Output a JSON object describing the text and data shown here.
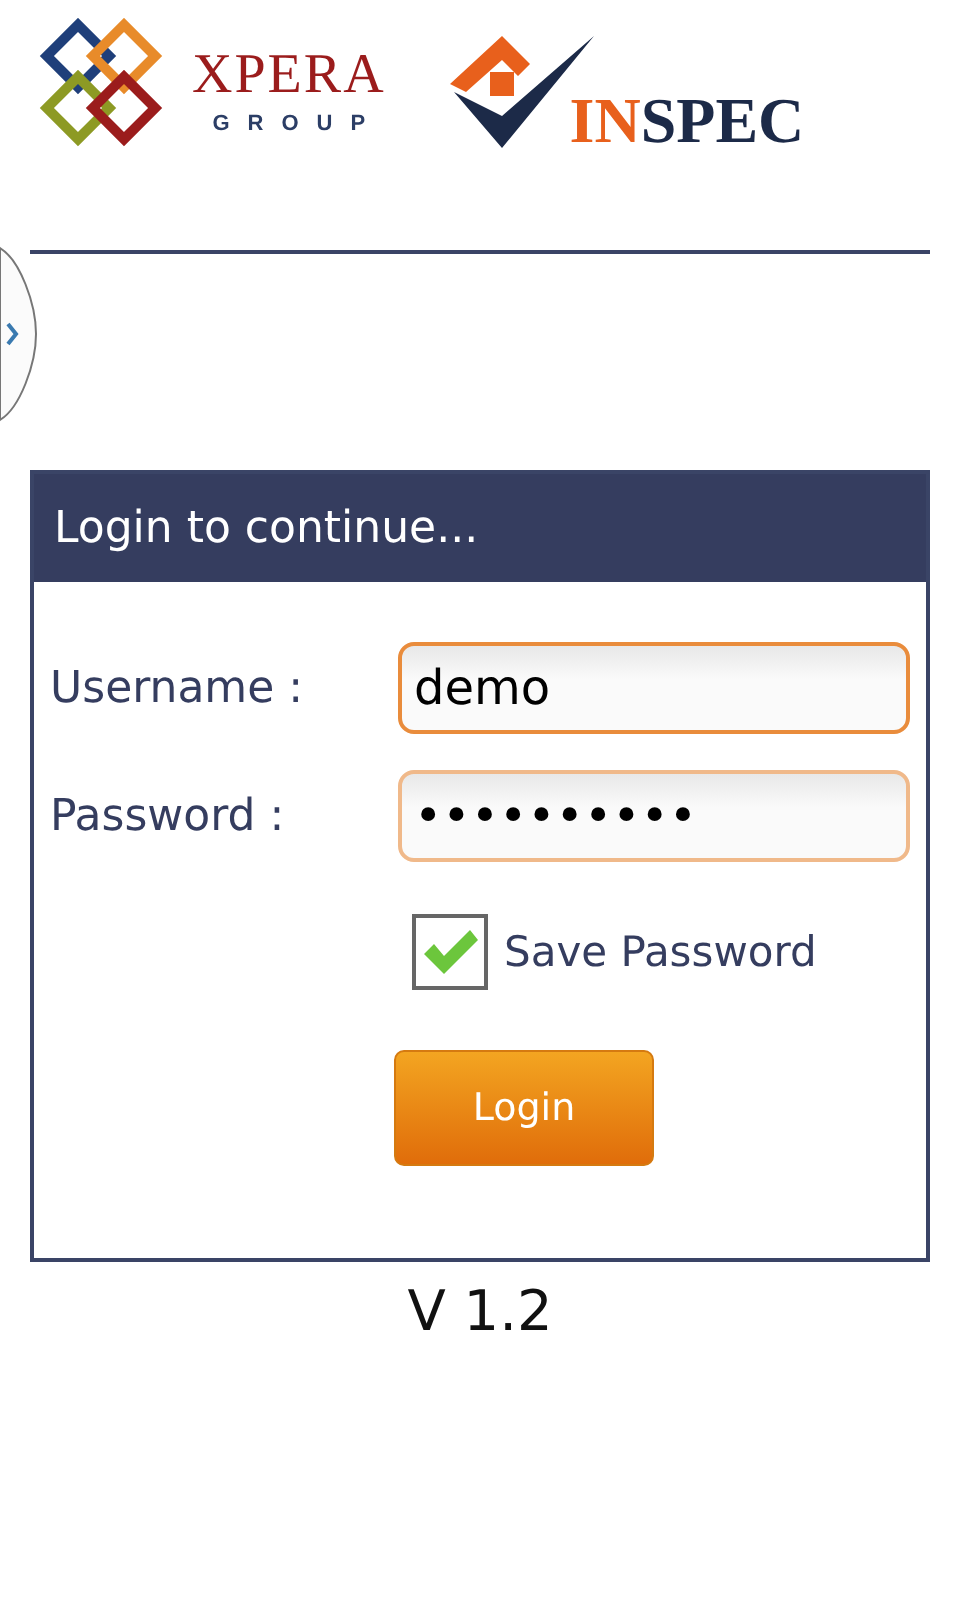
{
  "logos": [
    {
      "kind": "xpera",
      "name": "XPERA",
      "tagline": "GROUP"
    },
    {
      "kind": "inspec",
      "parts": [
        {
          "text": "IN",
          "color": "#e8601c"
        },
        {
          "text": "SPEC",
          "color": "#1c2a48"
        }
      ]
    }
  ],
  "login_panel": {
    "title": "Login to continue...",
    "fields": [
      {
        "label": "Username :",
        "value": "demo",
        "focused": true
      },
      {
        "label": "Password :",
        "value": "••••••••••",
        "focused": false
      }
    ],
    "save_password": {
      "label": "Save Password",
      "checked": true
    },
    "button": "Login"
  },
  "version": "V 1.2"
}
